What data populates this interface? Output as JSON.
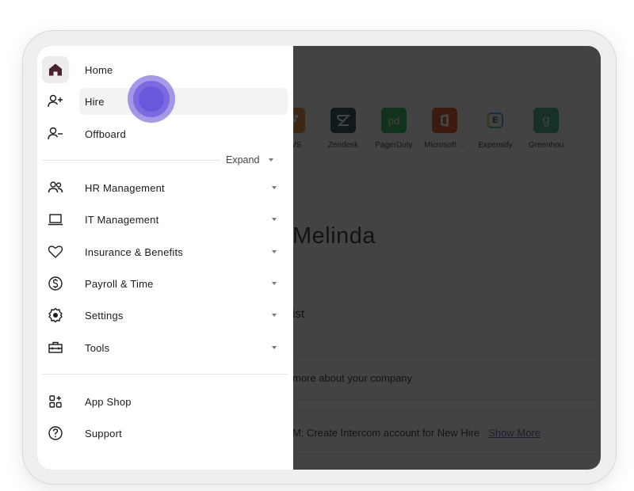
{
  "sidebar": {
    "top_items": [
      {
        "label": "Home",
        "icon": "home-icon",
        "active": true
      },
      {
        "label": "Hire",
        "icon": "user-plus-icon",
        "hovered": true
      },
      {
        "label": "Offboard",
        "icon": "user-minus-icon"
      }
    ],
    "expand_label": "Expand",
    "sections": [
      {
        "label": "HR Management",
        "icon": "people-icon"
      },
      {
        "label": "IT Management",
        "icon": "laptop-icon"
      },
      {
        "label": "Insurance & Benefits",
        "icon": "heart-icon"
      },
      {
        "label": "Payroll & Time",
        "icon": "dollar-circle-icon"
      },
      {
        "label": "Settings",
        "icon": "gear-icon"
      },
      {
        "label": "Tools",
        "icon": "toolbox-icon"
      }
    ],
    "bottom_items": [
      {
        "label": "App Shop",
        "icon": "app-grid-plus-icon"
      },
      {
        "label": "Support",
        "icon": "question-circle-icon"
      }
    ]
  },
  "main": {
    "apps": [
      {
        "label": "AWS",
        "color": "#e07b1a"
      },
      {
        "label": "Zendesk",
        "color": "#03363d"
      },
      {
        "label": "PagerDuty",
        "color": "#06ac38"
      },
      {
        "label": "Microsoft ...",
        "color": "#d83b01"
      },
      {
        "label": "Expensify",
        "color": "#f5f5f5"
      },
      {
        "label": "Greenhou",
        "color": "#24a47f"
      }
    ],
    "greeting": "Melinda",
    "checklist_title": "ist",
    "rows": [
      {
        "text": "more about your company"
      },
      {
        "text": "M: Create Intercom account for New Hire",
        "link": "Show More"
      }
    ]
  },
  "colors": {
    "accent": "#6a58dc",
    "home_icon": "#4a1f2e",
    "overlay": "#3d3d3d"
  }
}
